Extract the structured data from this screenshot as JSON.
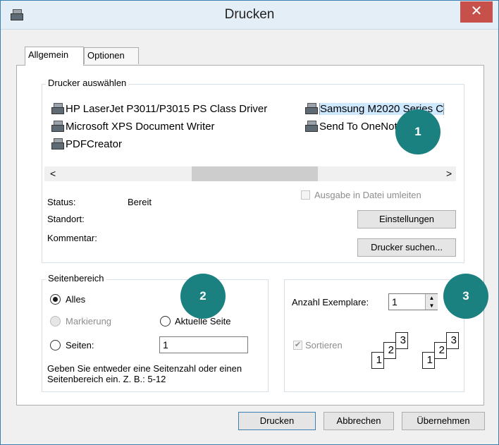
{
  "window": {
    "title": "Drucken",
    "close_glyph": "✕"
  },
  "tabs": [
    {
      "label": "Allgemein"
    },
    {
      "label": "Optionen"
    }
  ],
  "printer_group": {
    "legend": "Drucker auswählen",
    "printers": [
      "HP LaserJet P3011/P3015 PS Class Driver",
      "Microsoft XPS Document Writer",
      "PDFCreator",
      "Samsung M2020 Series C",
      "Send To OneNote 16"
    ],
    "selected_printer": "Samsung M2020 Series C",
    "scroll_left": "<",
    "scroll_right": ">",
    "status_label": "Status:",
    "status_value": "Bereit",
    "location_label": "Standort:",
    "comment_label": "Kommentar:",
    "print_to_file_label": "Ausgabe in Datei umleiten",
    "settings_button": "Einstellungen",
    "find_printer_button": "Drucker suchen..."
  },
  "page_range": {
    "legend": "Seitenbereich",
    "all_label": "Alles",
    "selection_label": "Markierung",
    "current_page_label": "Aktuelle Seite",
    "pages_label": "Seiten:",
    "pages_value": "1",
    "hint": "Geben Sie entweder eine Seitenzahl oder einen Seitenbereich ein. Z. B.: 5-12"
  },
  "copies": {
    "count_label": "Anzahl Exemplare:",
    "count_value": "1",
    "collate_label": "Sortieren",
    "collate_pages": [
      "1",
      "2",
      "3"
    ]
  },
  "footer": {
    "print_button": "Drucken",
    "cancel_button": "Abbrechen",
    "apply_button": "Übernehmen"
  },
  "callouts": [
    "1",
    "2",
    "3"
  ],
  "colors": {
    "callout": "#1b8080",
    "close": "#c7504b",
    "accent": "#3c7fb1"
  }
}
